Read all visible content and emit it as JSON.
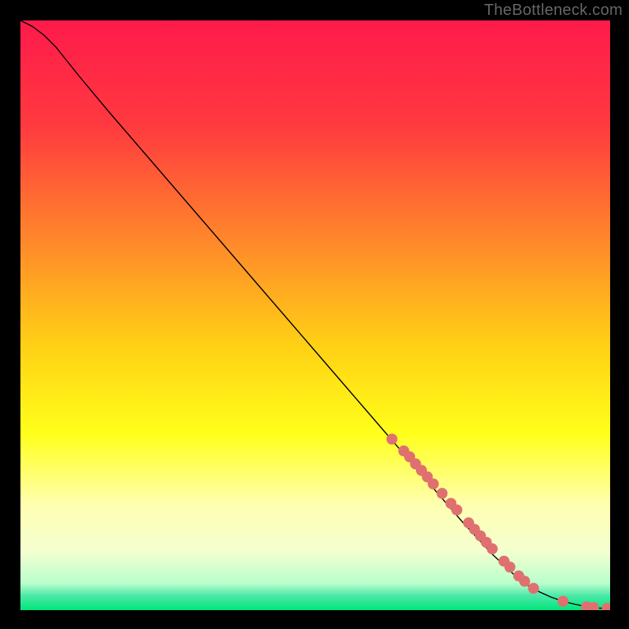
{
  "watermark": "TheBottleneck.com",
  "chart_data": {
    "type": "line",
    "title": "",
    "xlabel": "",
    "ylabel": "",
    "xlim": [
      0,
      100
    ],
    "ylim": [
      0,
      100
    ],
    "grid": false,
    "legend": false,
    "background_gradient_stops": [
      {
        "offset": 0.0,
        "color": "#ff1a4b"
      },
      {
        "offset": 0.18,
        "color": "#ff3a3f"
      },
      {
        "offset": 0.38,
        "color": "#ff8a2a"
      },
      {
        "offset": 0.55,
        "color": "#ffd015"
      },
      {
        "offset": 0.7,
        "color": "#ffff1a"
      },
      {
        "offset": 0.82,
        "color": "#ffffb0"
      },
      {
        "offset": 0.9,
        "color": "#f4ffd0"
      },
      {
        "offset": 0.955,
        "color": "#b8ffcc"
      },
      {
        "offset": 0.975,
        "color": "#4de8a8"
      },
      {
        "offset": 1.0,
        "color": "#00e67a"
      }
    ],
    "series": [
      {
        "name": "curve",
        "color": "#000000",
        "width": 1.4,
        "x": [
          0,
          2,
          4,
          6,
          8,
          10,
          15,
          20,
          25,
          30,
          35,
          40,
          45,
          50,
          55,
          60,
          65,
          70,
          75,
          80,
          85,
          88,
          90,
          92,
          94,
          95,
          96,
          97,
          98,
          99,
          100
        ],
        "y": [
          100,
          99,
          97.5,
          95.5,
          93,
          90.5,
          84.5,
          78.7,
          72.9,
          67.1,
          61.3,
          55.5,
          49.7,
          43.9,
          38.1,
          32.3,
          26.5,
          20.7,
          14.9,
          9.5,
          4.8,
          3.1,
          2.2,
          1.5,
          1.0,
          0.8,
          0.6,
          0.45,
          0.35,
          0.3,
          0.3
        ]
      }
    ],
    "markers": {
      "color": "#e07070",
      "radius_px": 7,
      "points": [
        {
          "x": 63,
          "y": 29.0
        },
        {
          "x": 65,
          "y": 27.0
        },
        {
          "x": 66,
          "y": 26.0
        },
        {
          "x": 67,
          "y": 24.8
        },
        {
          "x": 68,
          "y": 23.7
        },
        {
          "x": 69,
          "y": 22.6
        },
        {
          "x": 70,
          "y": 21.4
        },
        {
          "x": 71.5,
          "y": 19.8
        },
        {
          "x": 73,
          "y": 18.1
        },
        {
          "x": 74,
          "y": 17.0
        },
        {
          "x": 76,
          "y": 14.8
        },
        {
          "x": 77,
          "y": 13.7
        },
        {
          "x": 78,
          "y": 12.6
        },
        {
          "x": 79,
          "y": 11.5
        },
        {
          "x": 80,
          "y": 10.4
        },
        {
          "x": 82,
          "y": 8.3
        },
        {
          "x": 83,
          "y": 7.3
        },
        {
          "x": 84.5,
          "y": 5.8
        },
        {
          "x": 85.5,
          "y": 4.9
        },
        {
          "x": 87,
          "y": 3.7
        },
        {
          "x": 92,
          "y": 1.5
        },
        {
          "x": 96,
          "y": 0.55
        },
        {
          "x": 97.2,
          "y": 0.45
        },
        {
          "x": 99.5,
          "y": 0.3
        },
        {
          "x": 100.3,
          "y": 0.3
        }
      ]
    }
  }
}
